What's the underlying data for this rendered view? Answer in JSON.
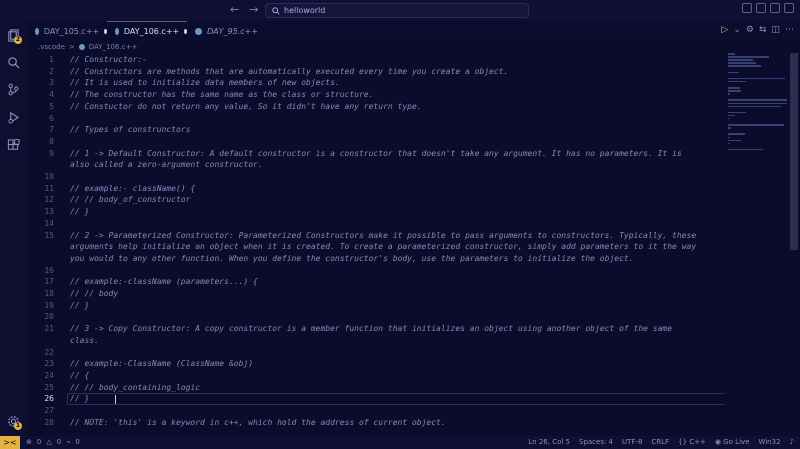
{
  "titlebar": {
    "search_text": "helloworld"
  },
  "activity_badges": {
    "explorer": "2",
    "account": "1"
  },
  "tabs": [
    {
      "name": "DAY_105.c++",
      "active": false,
      "dirty": true,
      "italic": false
    },
    {
      "name": "DAY_106.c++",
      "active": true,
      "dirty": true,
      "italic": false
    },
    {
      "name": "DAY_95.c++",
      "active": false,
      "dirty": false,
      "italic": true
    }
  ],
  "breadcrumb": {
    "folder": ".vscode",
    "separator": ">",
    "file": "DAY_106.c++"
  },
  "editor": {
    "current_line": "26",
    "lines": [
      {
        "n": "1",
        "text": "// Constructor:-"
      },
      {
        "n": "2",
        "text": "// Constructors are methods that are automatically executed every time you create a object."
      },
      {
        "n": "3",
        "text": "// It is used to initialize data members of new objects."
      },
      {
        "n": "4",
        "text": "// The constructor has the same name as the class or structure."
      },
      {
        "n": "5",
        "text": "// Constuctor do not return any value, So it didn't have any return type."
      },
      {
        "n": "6",
        "text": ""
      },
      {
        "n": "7",
        "text": "// Types of construnctors"
      },
      {
        "n": "8",
        "text": ""
      },
      {
        "n": "9",
        "text": "// 1 -> Default Constructor: A default constructor is a constructor that doesn't take any argument. It has no parameters. It is"
      },
      {
        "n": "",
        "text": "also called a zero-argument constructor."
      },
      {
        "n": "10",
        "text": ""
      },
      {
        "n": "11",
        "text": "// example:- className() {"
      },
      {
        "n": "12",
        "text": "//     // body_of_constructor"
      },
      {
        "n": "13",
        "text": "// }"
      },
      {
        "n": "14",
        "text": ""
      },
      {
        "n": "15",
        "text": "// 2 -> Parameterized Constructor: Parameterized Constructors make it possible to pass arguments to constructors. Typically, these"
      },
      {
        "n": "",
        "text": "arguments help initialize an object when it is created. To create a parameterized constructor, simply add parameters to it the way"
      },
      {
        "n": "",
        "text": "you would to any other function. When you define the constructor's body, use the parameters to initialize the object."
      },
      {
        "n": "16",
        "text": ""
      },
      {
        "n": "17",
        "text": "// example:-className (parameters...) {"
      },
      {
        "n": "18",
        "text": "//       // body"
      },
      {
        "n": "19",
        "text": "// }"
      },
      {
        "n": "20",
        "text": ""
      },
      {
        "n": "21",
        "text": "// 3 -> Copy Constructor: A copy constructor is a member function that initializes an object using another object of the same"
      },
      {
        "n": "",
        "text": "class."
      },
      {
        "n": "22",
        "text": ""
      },
      {
        "n": "23",
        "text": "// example:-ClassName (ClassName &obj)"
      },
      {
        "n": "24",
        "text": "// {"
      },
      {
        "n": "25",
        "text": "//   // body_containing_logic"
      },
      {
        "n": "26",
        "text": "// }"
      },
      {
        "n": "27",
        "text": ""
      },
      {
        "n": "28",
        "text": "// NOTE: 'this' is a keyword in c++, which hold the address of current object."
      }
    ]
  },
  "statusbar": {
    "remote_icon": "><",
    "errors": "0",
    "warnings": "0",
    "ports": "0",
    "position": "Ln 26, Col 5",
    "spaces": "Spaces: 4",
    "encoding": "UTF-8",
    "eol": "CRLF",
    "language": "C++",
    "golive": "Go Live",
    "platform": "Win32"
  },
  "colors": {
    "background": "#0b0b2b",
    "accent": "#e3b341",
    "comment": "#8489b8"
  }
}
